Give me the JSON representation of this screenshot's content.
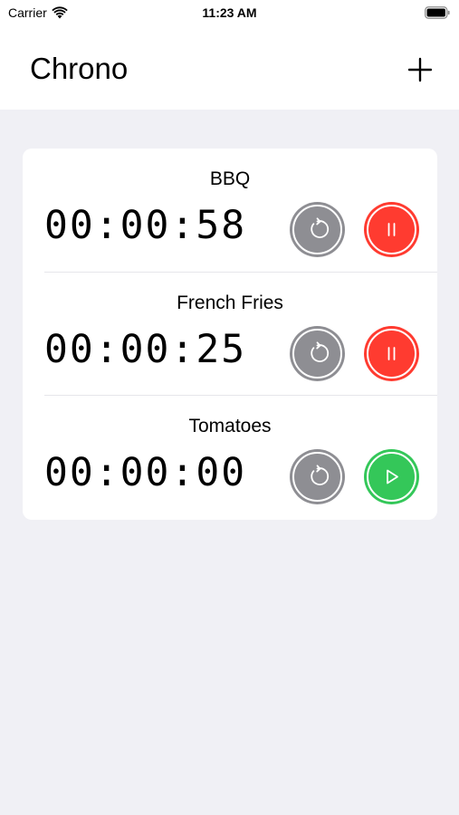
{
  "status_bar": {
    "carrier": "Carrier",
    "time": "11:23 AM"
  },
  "nav": {
    "title": "Chrono",
    "add_icon": "plus-icon"
  },
  "timers": [
    {
      "name": "BBQ",
      "time": "00:00:58",
      "state": "running",
      "action_icon": "pause-icon",
      "action_color": "#ff3b30"
    },
    {
      "name": "French Fries",
      "time": "00:00:25",
      "state": "running",
      "action_icon": "pause-icon",
      "action_color": "#ff3b30"
    },
    {
      "name": "Tomatoes",
      "time": "00:00:00",
      "state": "stopped",
      "action_icon": "play-icon",
      "action_color": "#34c759"
    }
  ],
  "colors": {
    "background": "#f0f0f5",
    "reset": "#8e8e93",
    "pause": "#ff3b30",
    "play": "#34c759"
  }
}
